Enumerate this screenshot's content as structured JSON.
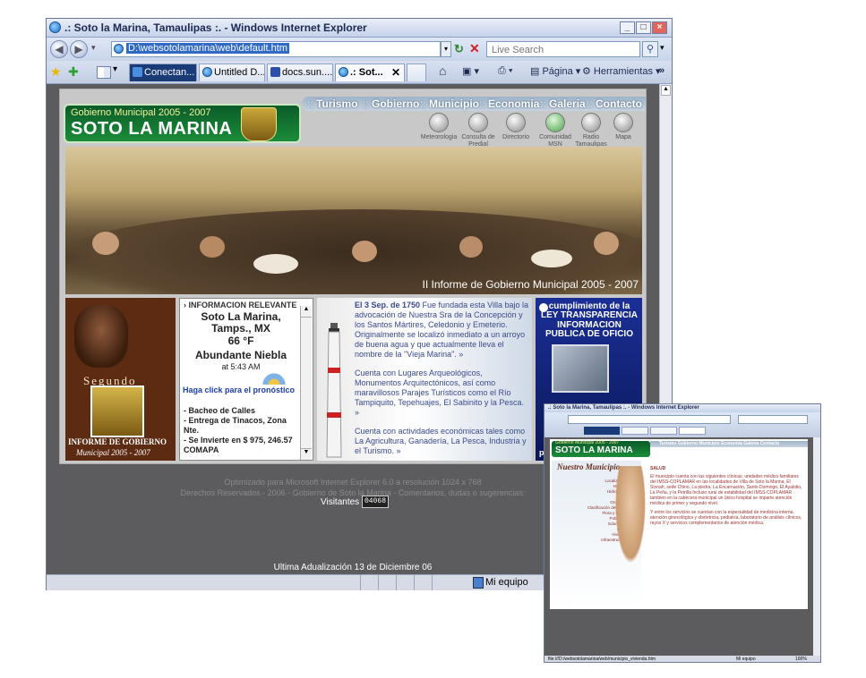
{
  "main_window": {
    "title": ".: Soto la Marina, Tamaulipas :. - Windows Internet Explorer",
    "address": "D:\\websotolamarina\\web\\default.htm",
    "search_placeholder": "Live Search",
    "tabs": [
      "Conectan...",
      "Untitled D...",
      "docs.sun....",
      ".: Sot..."
    ],
    "toolbar": {
      "page": "Página",
      "tools": "Herramientas"
    },
    "status_zone": "Mi equipo"
  },
  "site": {
    "logo": {
      "gov": "Gobierno Municipal 2005 - 2007",
      "name": "SOTO LA MARINA"
    },
    "menu": [
      "Turismo",
      "Gobierno",
      "Municipio",
      "Economia",
      "Galeria",
      "Contacto"
    ],
    "icons": [
      {
        "label": "Meteorologia",
        "icon": "weather-icon"
      },
      {
        "label": "Consulta de Predial",
        "icon": "predial-icon"
      },
      {
        "label": "Directorio",
        "icon": "directory-icon"
      },
      {
        "label": "Comunidad MSN",
        "icon": "msn-icon"
      },
      {
        "label": "Radio Tamaulipas",
        "icon": "radio-icon"
      },
      {
        "label": "Mapa",
        "icon": "map-icon"
      }
    ],
    "hero_caption": "II Informe de Gobierno Municipal  2005 - 2007",
    "informe": {
      "segundo": "Segundo",
      "line1": "INFORME DE GOBIERNO",
      "line2": "Municipal 2005 - 2007"
    },
    "info": {
      "header": "INFORMACION RELEVANTE",
      "city": "Soto La Marina, Tamps., MX",
      "temp": "66 °F",
      "condition": "Abundante Niebla",
      "time": "at 5:43 AM",
      "link": "Haga click para el pronóstico",
      "news": [
        "- Bacheo de Calles",
        "- Entrega de Tinacos, Zona Nte.",
        "- Se Invierte en $ 975, 246.57 COMAPA"
      ]
    },
    "history": {
      "p1_bold": "El 3 Sep. de 1750",
      "p1": " Fue fundada esta Villa bajo la advocación de Nuestra Sra de la Concepción y los Santos Mártires, Celedonio y Emeterio. Originalmente se localizó inmediato a un arroyo de buena agua y que actualmente lleva el nombre de la \"Vieja Marina\". »",
      "p2": "Cuenta con Lugares Arqueológicos, Monumentos Arquitectónicos, así como maravillosos Parajes Turísticos como el Río Tampiquito, Tepehuajes, El Sabinito y la Pesca. »",
      "p3": "Cuenta con actividades económicas tales como La Agricultura, Ganadería, La Pesca, Industria y el Turismo. »"
    },
    "transparency": {
      "t1": "cumplimiento de la LEY TRANSPARENCIA",
      "t2": "INFORMACION PUBLICA DE OFICIO",
      "foot": "por"
    },
    "footer1": "Optimizado para Microsoft Internet Explorer 6.0 a resolución 1024 x 768",
    "footer2": "Derechos Reservados - 2006 - Gobierno de Soto la Marina - Comentarios, dudas o sugerencias:",
    "visits_label": "Visitantes :",
    "visits_count": "04068",
    "updated": "Ultima Adualización 13 de Diciembre  06"
  },
  "second_window": {
    "title": ".: Soto la Marina, Tamaulipas :. - Windows Internet Explorer",
    "menu": "Turismo  Gobierno  Municipio  Economia  Galeria  Contacto",
    "section_title": "Nuestro Municipio",
    "items": [
      "Localización »",
      "Historia »",
      "Hidrografía »",
      "Clima »",
      "Orografía »",
      "Clasificación del suelo »",
      "Flora y Fauna »",
      "Población »",
      "Educación »",
      "Salud »",
      "Vivienda »",
      "Infraestructura »"
    ],
    "salud_title": "SALUD",
    "salud_text": "El municipio cuenta con las siguientes clínicas; unidades médico familiares del IMSS-COPLAMAR en las localidades de Villa de Soto la Marina, El Sinnah, sede Chino, La piedra, La Encarnación, Santo Domingo, El Ayalotio, La Peña, y la Petrilla Incluso rural de estabilidad del IMSS-COPLAMAR también en la cabecera municipal un único hospital se imparte atención médica de primer y segundo nivel.",
    "salud_text2": "Y entre los servicios se cuentan con la especialidad de medicina interna, atención ginecológica y obstetricia, pediatría, laboratorio de análisis clínicos, rayos X y servicios complementarios de atención médica.",
    "status": "file:///D:/websotolamarina/web/municipio_vivienda.htm",
    "zone": "Mi equipo",
    "zoom": "100%"
  }
}
